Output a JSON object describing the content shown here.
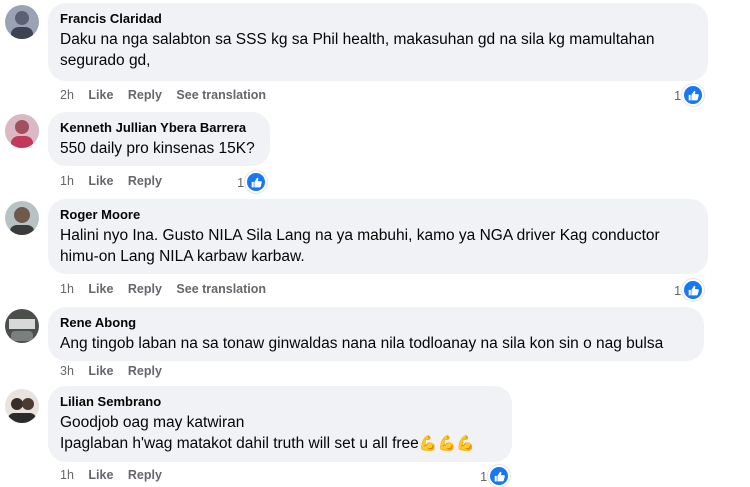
{
  "comments": [
    {
      "author": "Francis Claridad",
      "text": "Daku na nga salabton sa SSS kg sa Phil health, makasuhan gd na sila kg mamultahan segurado gd,",
      "time": "2h",
      "like": "Like",
      "reply": "Reply",
      "translate": "See translation",
      "reactions": "1"
    },
    {
      "author": "Kenneth Jullian Ybera Barrera",
      "text": "550 daily pro kinsenas 15K?",
      "time": "1h",
      "like": "Like",
      "reply": "Reply",
      "reactions": "1"
    },
    {
      "author": "Roger Moore",
      "text": "Halini nyo Ina. Gusto NILA Sila Lang na ya mabuhi, kamo ya NGA driver Kag conductor himu-on Lang NILA karbaw karbaw.",
      "time": "1h",
      "like": "Like",
      "reply": "Reply",
      "translate": "See translation",
      "reactions": "1"
    },
    {
      "author": "Rene Abong",
      "text": "Ang tingob laban na sa tonaw ginwaldas nana nila todloanay na sila kon sin o nag bulsa",
      "time": "3h",
      "like": "Like",
      "reply": "Reply"
    },
    {
      "author": "Lilian Sembrano",
      "text_line1": "Goodjob oag may katwiran",
      "text_line2": "Ipaglaban h'wag matakot dahil truth will set u all free",
      "emoji": "💪💪💪",
      "time": "1h",
      "like": "Like",
      "reply": "Reply",
      "reactions": "1"
    }
  ],
  "colors": {
    "bubble": "#f0f2f5",
    "like_blue": "#1877f2",
    "meta_gray": "#65676b"
  }
}
